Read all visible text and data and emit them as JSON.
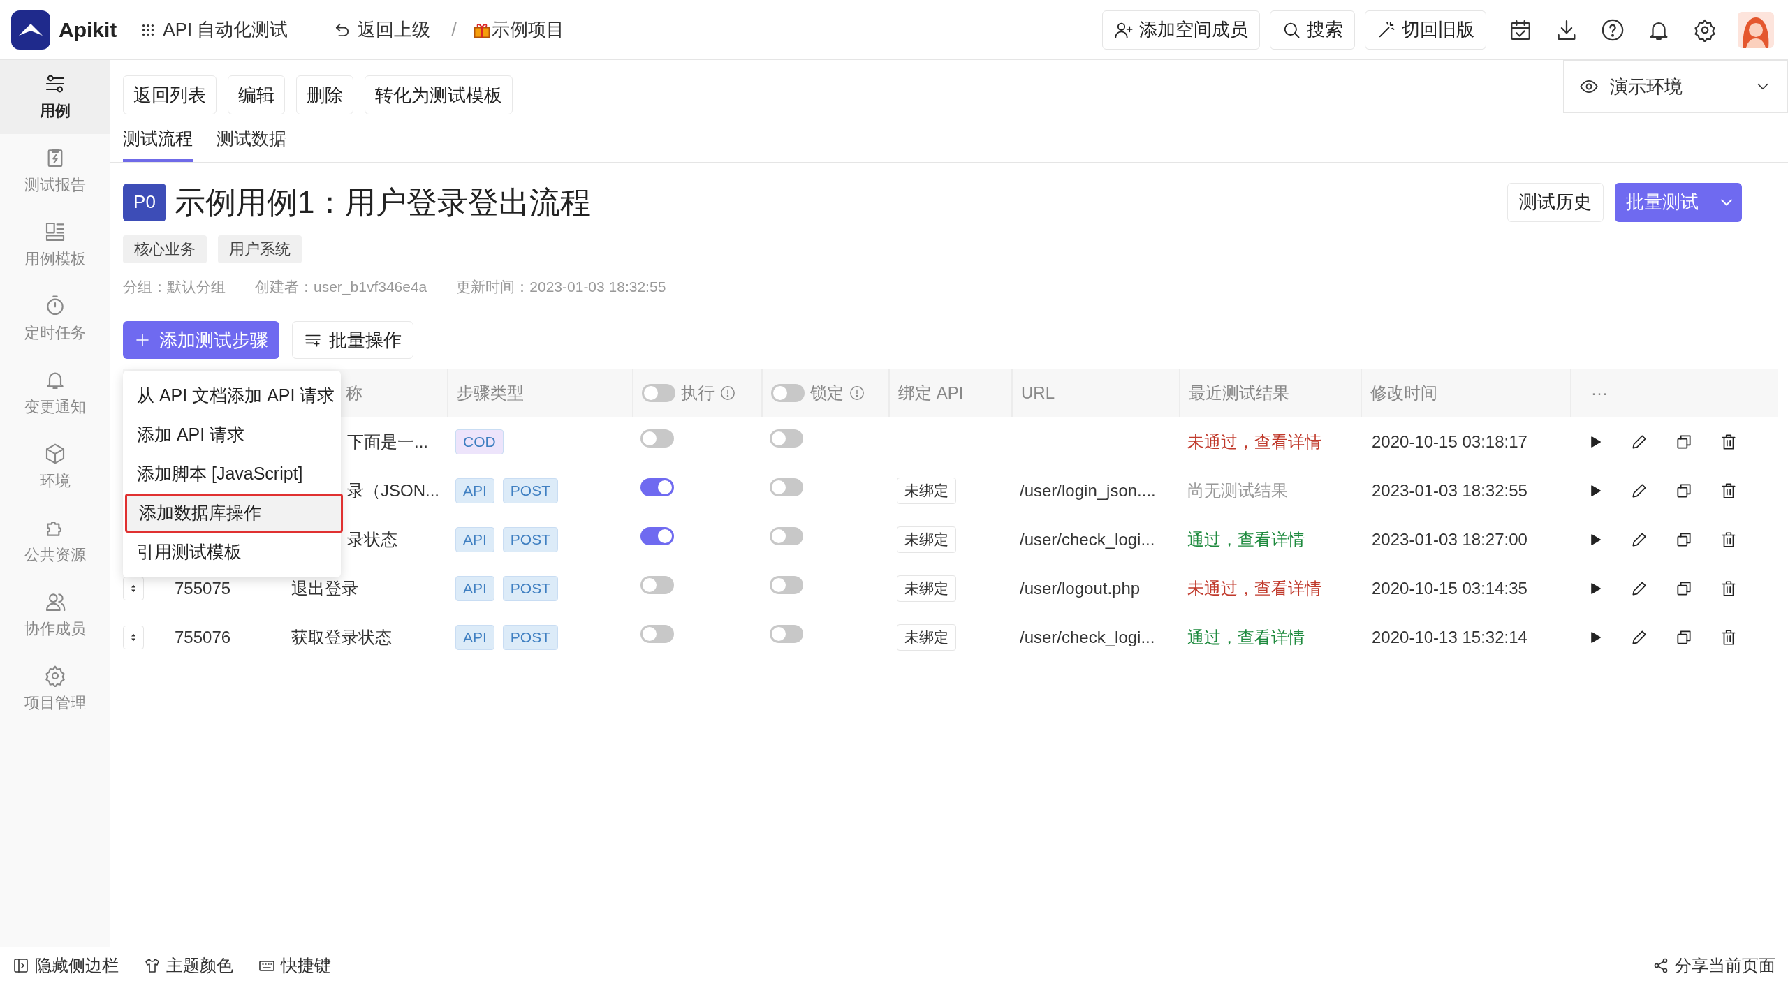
{
  "topbar": {
    "brand": "Apikit",
    "module": "API 自动化测试",
    "back": "返回上级",
    "separator": "/",
    "project": "示例项目",
    "buttons": [
      {
        "kind": "invite",
        "label": "添加空间成员"
      },
      {
        "kind": "search",
        "label": "搜索"
      },
      {
        "kind": "wand",
        "label": "切回旧版"
      }
    ]
  },
  "sidebar": {
    "items": [
      {
        "label": "用例",
        "selected": true
      },
      {
        "label": "测试报告",
        "selected": false
      },
      {
        "label": "用例模板",
        "selected": false
      },
      {
        "label": "定时任务",
        "selected": false
      },
      {
        "label": "变更通知",
        "selected": false
      },
      {
        "label": "环境",
        "selected": false
      },
      {
        "label": "公共资源",
        "selected": false
      },
      {
        "label": "协作成员",
        "selected": false
      },
      {
        "label": "项目管理",
        "selected": false
      }
    ]
  },
  "toolbar": [
    "返回列表",
    "编辑",
    "删除",
    "转化为测试模板"
  ],
  "environment": {
    "label": "演示环境"
  },
  "tabs": [
    {
      "label": "测试流程",
      "selected": true
    },
    {
      "label": "测试数据",
      "selected": false
    }
  ],
  "case": {
    "priority": "P0",
    "title": "示例用例1：用户登录登出流程",
    "tags": [
      "核心业务",
      "用户系统"
    ],
    "meta": [
      "分组：默认分组",
      "创建者：user_b1vf346e4a",
      "更新时间：2023-01-03 18:32:55"
    ],
    "history_button": "测试历史",
    "run_button": "批量测试"
  },
  "actions": {
    "add_step": "添加测试步骤",
    "batch": "批量操作"
  },
  "menu": {
    "items": [
      {
        "label": "从 API 文档添加 API 请求",
        "selected": false
      },
      {
        "label": "添加 API 请求",
        "selected": false
      },
      {
        "label": "添加脚本 [JavaScript]",
        "selected": false
      },
      {
        "label": "添加数据库操作",
        "selected": true
      },
      {
        "label": "引用测试模板",
        "selected": false
      }
    ]
  },
  "table": {
    "columns": [
      {
        "label": "称"
      },
      {
        "label": "步骤类型"
      },
      {
        "label": "执行",
        "on": false
      },
      {
        "label": "锁定",
        "on": false
      },
      {
        "label": "绑定 API"
      },
      {
        "label": "URL"
      },
      {
        "label": "最近测试结果"
      },
      {
        "label": "修改时间"
      },
      {
        "label": "···"
      }
    ],
    "rows": [
      {
        "name": "下面是一...",
        "tags": [
          {
            "label": "COD",
            "color": "#ede4fb"
          }
        ],
        "execute": false,
        "locked": false,
        "result": {
          "text": "未通过，查看详情",
          "kind": "fail"
        },
        "modified": "2020-10-15 03:18:17"
      },
      {
        "name": "录（JSON...",
        "tags": [
          {
            "label": "API",
            "color": "#dcebf8"
          },
          {
            "label": "POST",
            "color": "#dcebf8"
          }
        ],
        "execute": true,
        "locked": false,
        "binding": "未绑定",
        "url": "/user/login_json....",
        "result": {
          "text": "尚无测试结果",
          "kind": "none"
        },
        "modified": "2023-01-03 18:32:55"
      },
      {
        "name": "录状态",
        "tags": [
          {
            "label": "API",
            "color": "#dcebf8"
          },
          {
            "label": "POST",
            "color": "#dcebf8"
          }
        ],
        "execute": true,
        "locked": false,
        "binding": "未绑定",
        "url": "/user/check_logi...",
        "result": {
          "text": "通过，查看详情",
          "kind": "pass"
        },
        "modified": "2023-01-03 18:27:00"
      },
      {
        "id": "755075",
        "name": "退出登录",
        "tags": [
          {
            "label": "API",
            "color": "#dcebf8"
          },
          {
            "label": "POST",
            "color": "#dcebf8"
          }
        ],
        "execute": false,
        "locked": false,
        "binding": "未绑定",
        "url": "/user/logout.php",
        "result": {
          "text": "未通过，查看详情",
          "kind": "fail"
        },
        "modified": "2020-10-15 03:14:35"
      },
      {
        "id": "755076",
        "name": "获取登录状态",
        "tags": [
          {
            "label": "API",
            "color": "#dcebf8"
          },
          {
            "label": "POST",
            "color": "#dcebf8"
          }
        ],
        "execute": false,
        "locked": false,
        "binding": "未绑定",
        "url": "/user/check_logi...",
        "result": {
          "text": "通过，查看详情",
          "kind": "pass"
        },
        "modified": "2020-10-13 15:32:14"
      }
    ]
  },
  "footer": {
    "left": [
      {
        "kind": "sidebar",
        "label": "隐藏侧边栏"
      },
      {
        "kind": "shirt",
        "label": "主题颜色"
      },
      {
        "kind": "keyboard",
        "label": "快捷键"
      }
    ],
    "share": "分享当前页面"
  }
}
